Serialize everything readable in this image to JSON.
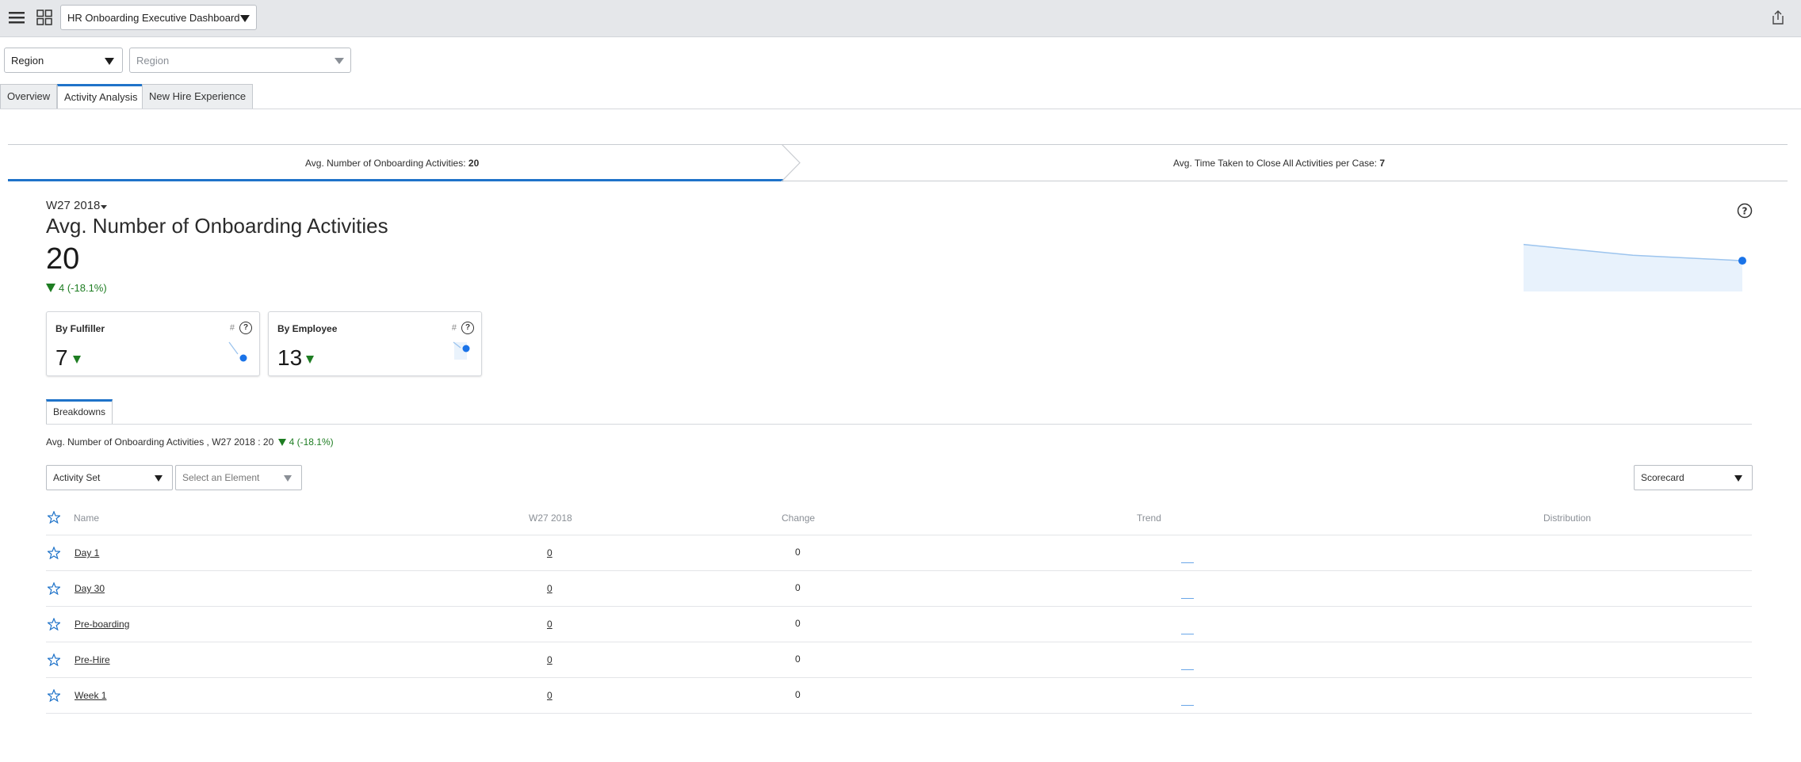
{
  "header": {
    "dashboard_title": "HR Onboarding Executive Dashboard",
    "menu_icon": "hamburger-menu-icon",
    "grid_icon": "grid-view-icon",
    "share_icon": "share-icon"
  },
  "filters": {
    "region_select": "Region",
    "region_placeholder": "Region"
  },
  "tabs": [
    {
      "label": "Overview",
      "active": false
    },
    {
      "label": "Activity Analysis",
      "active": true
    },
    {
      "label": "New Hire Experience",
      "active": false
    }
  ],
  "metric_band": {
    "left_label": "Avg. Number of Onboarding Activities:",
    "left_value": "20",
    "right_label": "Avg. Time Taken to Close All Activities per Case:",
    "right_value": "7"
  },
  "main": {
    "period": "W27 2018",
    "title": "Avg. Number of Onboarding Activities",
    "value": "20",
    "change": "4 (-18.1%)",
    "help_icon": "question-circle-icon",
    "sparkline": [
      26,
      20,
      17
    ]
  },
  "cards": [
    {
      "title": "By Fulfiller",
      "value": "7",
      "hash": "#"
    },
    {
      "title": "By Employee",
      "value": "13",
      "hash": "#"
    }
  ],
  "breakdown": {
    "tab_label": "Breakdowns",
    "summary_prefix": "Avg. Number of Onboarding Activities , W27 2018 : 20",
    "summary_change": "4 (-18.1%)",
    "group_select": "Activity Set",
    "element_placeholder": "Select an Element",
    "view_select": "Scorecard"
  },
  "table": {
    "headers": {
      "name": "Name",
      "period": "W27 2018",
      "change": "Change",
      "trend": "Trend",
      "distribution": "Distribution"
    },
    "rows": [
      {
        "name": "Day 1",
        "value": "0",
        "change": "0"
      },
      {
        "name": "Day 30",
        "value": "0",
        "change": "0"
      },
      {
        "name": "Pre-boarding",
        "value": "0",
        "change": "0"
      },
      {
        "name": "Pre-Hire",
        "value": "0",
        "change": "0"
      },
      {
        "name": "Week 1",
        "value": "0",
        "change": "0"
      }
    ]
  },
  "colors": {
    "accent": "#1f73c9",
    "positive_change": "#1e7d22",
    "sparkline_fill": "#e8f2fc",
    "sparkline_line": "#9cc4ee"
  }
}
